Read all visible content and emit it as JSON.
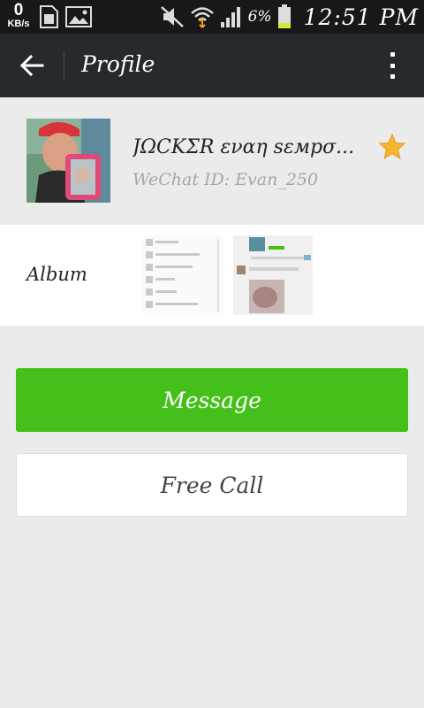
{
  "status_bar": {
    "speed_value": "0",
    "speed_unit": "KB/s",
    "battery_percent": "6%",
    "time": "12:51 PM"
  },
  "action_bar": {
    "title": "Profile"
  },
  "profile": {
    "display_name": "JΩCKΣR εναη sεмpσ...",
    "wechat_id": "WeChat ID: Evan_250",
    "starred": true
  },
  "album": {
    "label": "Album"
  },
  "buttons": {
    "message": "Message",
    "free_call": "Free Call"
  },
  "colors": {
    "accent_green": "#45c01a",
    "action_bar": "#262a2c",
    "status_bar": "#181818",
    "star": "#f7b52c"
  }
}
